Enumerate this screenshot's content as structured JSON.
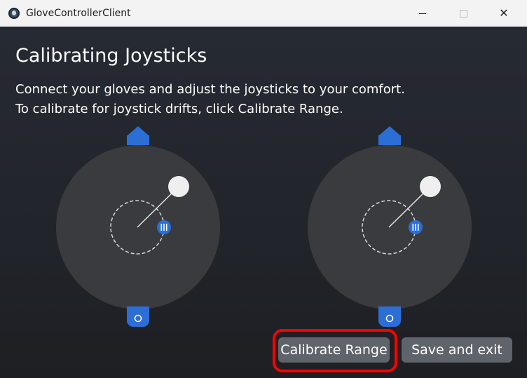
{
  "window": {
    "title": "GloveControllerClient",
    "controls": {
      "minimize_icon": "minimize-icon",
      "maximize_icon": "maximize-icon",
      "close_icon": "close-icon"
    }
  },
  "main": {
    "heading": "Calibrating Joysticks",
    "description_line1": "Connect your gloves and adjust the joysticks to your comfort.",
    "description_line2": "To calibrate for joystick drifts, click Calibrate Range."
  },
  "joysticks": [
    {
      "side": "left",
      "top_marker": "arrow-up-icon",
      "bottom_marker": "circle-icon",
      "center_badge": "menu-lines-icon"
    },
    {
      "side": "right",
      "top_marker": "arrow-up-icon",
      "bottom_marker": "circle-icon",
      "center_badge": "menu-lines-icon"
    }
  ],
  "buttons": {
    "calibrate_label": "Calibrate Range",
    "save_label": "Save and exit"
  },
  "colors": {
    "accent_blue": "#2b6fd6",
    "pad_gray": "#3a3b3f",
    "button_gray": "#5f636a",
    "highlight_red": "#ff0000"
  }
}
